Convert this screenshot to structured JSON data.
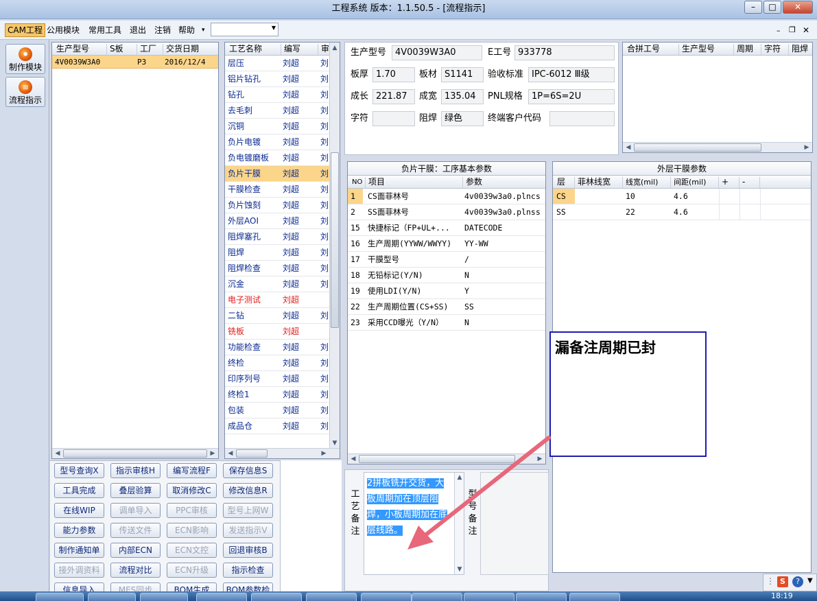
{
  "window": {
    "title": "工程系统  版本：1.1.50.5 - [流程指示]"
  },
  "menu": {
    "items": [
      "CAM工程",
      "公用模块",
      "常用工具",
      "退出",
      "注销",
      "帮助"
    ],
    "more": "▾"
  },
  "sidebar": {
    "items": [
      {
        "label": "制作模块",
        "icon": "fire-icon"
      },
      {
        "label": "流程指示",
        "icon": "process-icon"
      }
    ]
  },
  "orders": {
    "headers": [
      "生产型号",
      "S板",
      "工厂",
      "交货日期"
    ],
    "rows": [
      {
        "model": "4V0039W3A0",
        "s": "",
        "factory": "P3",
        "date": "2016/12/4"
      }
    ]
  },
  "process": {
    "headers": [
      "工艺名称",
      "编写",
      "审"
    ],
    "rows": [
      {
        "name": "层压",
        "writer": "刘超",
        "rev": "刘"
      },
      {
        "name": "铝片钻孔",
        "writer": "刘超",
        "rev": "刘"
      },
      {
        "name": "钻孔",
        "writer": "刘超",
        "rev": "刘"
      },
      {
        "name": "去毛刺",
        "writer": "刘超",
        "rev": "刘"
      },
      {
        "name": "沉铜",
        "writer": "刘超",
        "rev": "刘"
      },
      {
        "name": "负片电镀",
        "writer": "刘超",
        "rev": "刘"
      },
      {
        "name": "负电镀磨板",
        "writer": "刘超",
        "rev": "刘"
      },
      {
        "name": "负片干膜",
        "writer": "刘超",
        "rev": "刘",
        "selected": true
      },
      {
        "name": "干膜检查",
        "writer": "刘超",
        "rev": "刘"
      },
      {
        "name": "负片蚀刻",
        "writer": "刘超",
        "rev": "刘"
      },
      {
        "name": "外层AOI",
        "writer": "刘超",
        "rev": "刘"
      },
      {
        "name": "阻焊塞孔",
        "writer": "刘超",
        "rev": "刘"
      },
      {
        "name": "阻焊",
        "writer": "刘超",
        "rev": "刘"
      },
      {
        "name": "阻焊检查",
        "writer": "刘超",
        "rev": "刘"
      },
      {
        "name": "沉金",
        "writer": "刘超",
        "rev": "刘"
      },
      {
        "name": "电子测试",
        "writer": "刘超",
        "rev": "",
        "red": true
      },
      {
        "name": "二钻",
        "writer": "刘超",
        "rev": "刘"
      },
      {
        "name": "铣板",
        "writer": "刘超",
        "rev": "",
        "red": true
      },
      {
        "name": "功能检查",
        "writer": "刘超",
        "rev": "刘"
      },
      {
        "name": "终检",
        "writer": "刘超",
        "rev": "刘"
      },
      {
        "name": "印序列号",
        "writer": "刘超",
        "rev": "刘"
      },
      {
        "name": "终检1",
        "writer": "刘超",
        "rev": "刘"
      },
      {
        "name": "包装",
        "writer": "刘超",
        "rev": "刘"
      },
      {
        "name": "成品仓",
        "writer": "刘超",
        "rev": "刘"
      }
    ]
  },
  "actions": [
    [
      {
        "label": "型号查询X",
        "enabled": true
      },
      {
        "label": "指示审核H",
        "enabled": true
      },
      {
        "label": "编写流程F",
        "enabled": true
      },
      {
        "label": "保存信息S",
        "enabled": true
      }
    ],
    [
      {
        "label": "工具完成",
        "enabled": true
      },
      {
        "label": "叠层验算",
        "enabled": true
      },
      {
        "label": "取消修改C",
        "enabled": true
      },
      {
        "label": "修改信息R",
        "enabled": true
      }
    ],
    [
      {
        "label": "在线WIP",
        "enabled": true
      },
      {
        "label": "调单导入",
        "enabled": false
      },
      {
        "label": "PPC审核",
        "enabled": false
      },
      {
        "label": "型号上网W",
        "enabled": false
      }
    ],
    [
      {
        "label": "能力参数",
        "enabled": true
      },
      {
        "label": "传送文件",
        "enabled": false
      },
      {
        "label": "ECN影响",
        "enabled": false
      },
      {
        "label": "发送指示V",
        "enabled": false
      }
    ],
    [
      {
        "label": "制作通知单",
        "enabled": true
      },
      {
        "label": "内部ECN",
        "enabled": true
      },
      {
        "label": "ECN文控",
        "enabled": false
      },
      {
        "label": "回退审核B",
        "enabled": true
      }
    ],
    [
      {
        "label": "接外调资料",
        "enabled": false
      },
      {
        "label": "流程对比",
        "enabled": true
      },
      {
        "label": "ECN升级",
        "enabled": false
      },
      {
        "label": "指示检查",
        "enabled": true
      }
    ],
    [
      {
        "label": "信息导入",
        "enabled": true
      },
      {
        "label": "MES同步",
        "enabled": false
      },
      {
        "label": "BOM生成",
        "enabled": true
      },
      {
        "label": "BOM参数检查",
        "enabled": true
      }
    ]
  ],
  "info": {
    "model_label": "生产型号",
    "model": "4V0039W3A0",
    "e_label": "E工号",
    "e_value": "933778",
    "thick_label": "板厚",
    "thick": "1.70",
    "material_label": "板材",
    "material": "S1141",
    "std_label": "验收标准",
    "std": "IPC-6012 Ⅲ级",
    "len_label": "成长",
    "len": "221.87",
    "wid_label": "成宽",
    "wid": "135.04",
    "pnl_label": "PNL规格",
    "pnl": "1P=6S=2U",
    "char_label": "字符",
    "char": "",
    "mask_label": "阻焊",
    "mask": "绿色",
    "cust_label": "终端客户代码",
    "cust": ""
  },
  "merge": {
    "headers": [
      "合拼工号",
      "生产型号",
      "周期",
      "字符",
      "阻焊"
    ]
  },
  "params": {
    "title": "负片干膜：工序基本参数",
    "headers": [
      "NO",
      "项目",
      "参数"
    ],
    "rows": [
      {
        "no": "1",
        "item": "CS面菲林号",
        "value": "4v0039w3a0.plncs",
        "selected": true
      },
      {
        "no": "2",
        "item": "SS面菲林号",
        "value": "4v0039w3a0.plnss"
      },
      {
        "no": "15",
        "item": "快捷标记（FP+UL+...",
        "value": "DATECODE"
      },
      {
        "no": "16",
        "item": "生产周期(YYWW/WWYY)",
        "value": "YY-WW"
      },
      {
        "no": "17",
        "item": "干膜型号",
        "value": "/"
      },
      {
        "no": "18",
        "item": "无铅标记(Y/N)",
        "value": "N"
      },
      {
        "no": "19",
        "item": "使用LDI(Y/N)",
        "value": "Y"
      },
      {
        "no": "22",
        "item": "生产周期位置(CS+SS)",
        "value": "SS"
      },
      {
        "no": "23",
        "item": "采用CCD曝光（Y/N）",
        "value": "N"
      }
    ]
  },
  "outer": {
    "title": "外层干膜参数",
    "headers": [
      "层",
      "菲林线宽",
      "线宽(mil)",
      "间距(mil)",
      "+",
      "-"
    ],
    "rows": [
      {
        "layer": "CS",
        "film": "",
        "width": "10",
        "space": "4.6"
      },
      {
        "layer": "SS",
        "film": "",
        "width": "22",
        "space": "4.6"
      }
    ]
  },
  "notes": {
    "craft_label": "工艺备注",
    "craft_text": "2拼板铣开交货，大板周期加在顶层阻焊，小板周期加在底层线路。",
    "model_label": "型号备注",
    "model_text": ""
  },
  "annotation": {
    "text": "漏备注周期已封"
  },
  "tray": {
    "time": "18:19"
  },
  "colors": {
    "accent": "#fbd58a",
    "annotation": "#cc22cc",
    "arrow": "#e8677a",
    "red": "#e21b1b"
  }
}
